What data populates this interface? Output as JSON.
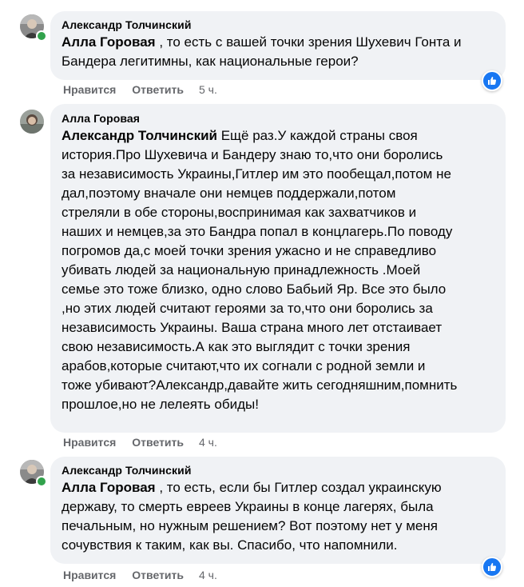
{
  "comments": [
    {
      "author": "Александр Толчинский",
      "mention": "Алла Горовая",
      "text": " , то есть с вашей точки зрения Шухевич Гонта и\nБандера легитимны, как национальные герои?",
      "like_label": "Нравится",
      "reply_label": "Ответить",
      "time": "5 ч.",
      "has_reaction": true,
      "reaction_icon": "like-icon",
      "online": true
    },
    {
      "author": "Алла Горовая",
      "mention": "Александр Толчинский",
      "text": " Ещё раз.У каждой страны своя\nистория.Про Шухевича и Бандеру знаю то,что они боролись\nза независимость Украины,Гитлер им это пообещал,потом не\nдал,поэтому вначале они немцев поддержали,потом\nстреляли в обе стороны,воспринимая как захватчиков и\nнаших и немцев,за это Бандра попал в концлагерь.По поводу\nпогромов да,с моей точки зрения ужасно и не справедливо\nубивать людей за национальную принадлежность .Моей\nсемье это тоже близко, одно слово Бабьий Яр. Все это было\n,но этих людей считают героями за то,что они боролись за\nнезависимость Украины. Ваша страна много лет отстаивает\nсвою независимость.А как это выглядит с точки зрения\nарабов,которые считают,что их согнали с родной земли и\nтоже убивают?Александр,давайте жить сегодняшним,помнить\nпрошлое,но не лелеять обиды!",
      "like_label": "Нравится",
      "reply_label": "Ответить",
      "time": "4 ч.",
      "has_reaction": false,
      "online": false
    },
    {
      "author": "Александр Толчинский",
      "mention": "Алла Горовая",
      "text": " , то есть, если бы Гитлер создал украинскую\nдержаву, то смерть евреев Украины в конце лагерях, была\nпечальным, но нужным решением? Вот поэтому нет у меня\nсочувствия к таким, как вы. Спасибо, что напомнили.",
      "like_label": "Нравится",
      "reply_label": "Ответить",
      "time": "4 ч.",
      "has_reaction": true,
      "reaction_icon": "like-icon",
      "online": true
    }
  ],
  "colors": {
    "bubble": "#f0f2f5",
    "meta": "#65676b",
    "online": "#31a24c",
    "like_blue": "#1877f2"
  }
}
